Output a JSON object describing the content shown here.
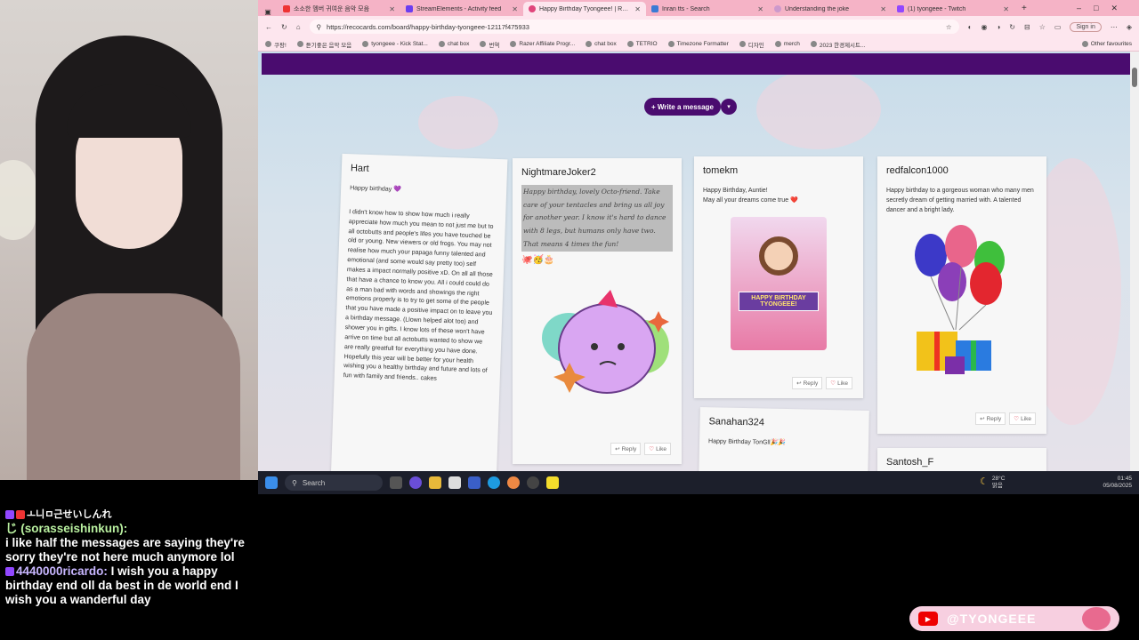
{
  "tabs": [
    {
      "label": "소소한 멤버 귀여운 음악 모음",
      "color": "#e33"
    },
    {
      "label": "StreamElements - Activity feed",
      "color": "#6a3df0"
    },
    {
      "label": "Happy Birthday Tyongeee! | Reco",
      "color": "#e0457b",
      "active": true
    },
    {
      "label": "Inran tts - Search",
      "color": "#3a7bd5"
    },
    {
      "label": "Understanding the joke",
      "color": "#c9c"
    },
    {
      "label": "(1) tyongeee - Twitch",
      "color": "#9147ff"
    }
  ],
  "url": "https://recocards.com/board/happy-birthday-tyongeee-12117f475933",
  "signin": "Sign in",
  "bookmarks": [
    "쿠팡!",
    "듣기좋은 음악 모음",
    "tyongeee - Kick Stat...",
    "chat box",
    "번역",
    "Razer Affiliate Progr...",
    "chat box",
    "TETRIO",
    "Timezone Formatter",
    "디자인",
    "merch",
    "2023 한경제시트...",
    "Other favourites"
  ],
  "write_button": "+ Write a message",
  "cards": [
    {
      "author": "Hart",
      "greeting": "Happy birthday 💜",
      "body": "I didn't know how to show how much i really appreciate how much you mean to not just me but to all octobutts and people's lifes you have touched be old or young. New viewers or old frogs. You may not realise how much your papaga funny talented and emotional (and some would say pretty too) self makes a impact normally positive xD. On all all those that have a chance to know you. All i could could do as a man bad with words and showings the right emotions properly is to try to get some of the people that you have made a positive impact on to leave you a birthday message. (Llown helped alot too) and shower you in gifts. I know lots of these won't have arrive on time but all actobutts wanted to show we are really greatfull for everything you have done. Hopefully this year will be better for your health wishing you a healthy birthday and future and lots of fun with family and friends.. cakes"
    },
    {
      "author": "NightmareJoker2",
      "body": "Happy birthday, lovely Octo-friend. Take care of your tentacles and bring us all joy for another year. I know it's hard to dance with 8 legs, but humans only have two. That means 4 times the fun!",
      "emojis": "🐙🥳🎂",
      "reply": "Reply",
      "like": "Like"
    },
    {
      "author": "tomekm",
      "line1": "Happy Birthday, Auntie!",
      "line2": "May all your dreams come true ❤️",
      "image_text": "HAPPY BIRTHDAY TYONGEEE!",
      "reply": "Reply",
      "like": "Like"
    },
    {
      "author": "redfalcon1000",
      "body": "Happy birthday to a gorgeous woman who many men secretly dream of getting married with. A talented dancer and a bright lady.",
      "reply": "Reply",
      "like": "Like"
    },
    {
      "author": "Sanahan324",
      "body": "Happy Birthday TonGll🎉🎉"
    },
    {
      "author": "Santosh_F"
    }
  ],
  "taskbar": {
    "search": "Search",
    "temp": "28°C",
    "weather": "맑음",
    "time": "01:45",
    "date": "05/08/2025"
  },
  "chat": [
    {
      "user": "ㅗ니ㅁ근せいしんれ",
      "user2": "じ (sorasseishinkun):",
      "text": "i like half the messages are saying they're sorry they're not here much anymore lol"
    },
    {
      "user": "4440000ricardo:",
      "text": "I wish you a happy birthday end oll da best in de world end I wish you a wanderful day"
    }
  ],
  "watermark": "@TYONGEEE",
  "colors": {
    "accent": "#4a0c6f",
    "tabbar": "#f5b3c6",
    "toolbar": "#fde6ee"
  }
}
